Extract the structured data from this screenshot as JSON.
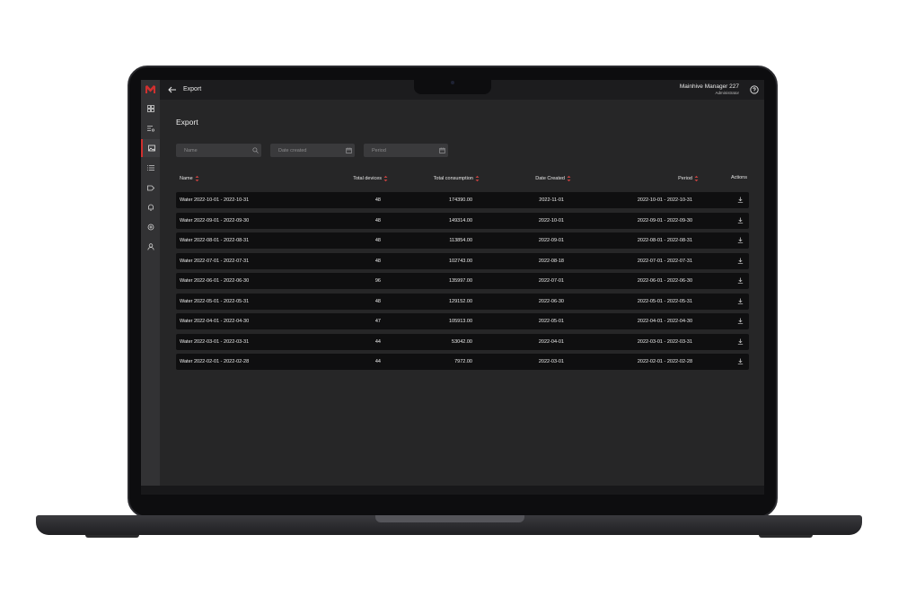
{
  "topbar": {
    "title": "Export",
    "user_name": "Mainhive Manager 227",
    "user_role": "Administrator"
  },
  "page": {
    "title": "Export"
  },
  "filters": {
    "name_placeholder": "Name",
    "date_created_placeholder": "Date created",
    "period_placeholder": "Period"
  },
  "columns": {
    "name": "Name",
    "total_devices": "Total devices",
    "total_consumption": "Total consumption",
    "date_created": "Date Created",
    "period": "Period",
    "actions": "Actions"
  },
  "rows": [
    {
      "name": "Water 2022-10-01 - 2022-10-31",
      "devices": "48",
      "consumption": "174390.00",
      "created": "2022-11-01",
      "period": "2022-10-01 - 2022-10-31"
    },
    {
      "name": "Water 2022-09-01 - 2022-09-30",
      "devices": "48",
      "consumption": "149314.00",
      "created": "2022-10-01",
      "period": "2022-09-01 - 2022-09-30"
    },
    {
      "name": "Water 2022-08-01 - 2022-08-31",
      "devices": "48",
      "consumption": "113854.00",
      "created": "2022-09-01",
      "period": "2022-08-01 - 2022-08-31"
    },
    {
      "name": "Water 2022-07-01 - 2022-07-31",
      "devices": "48",
      "consumption": "102743.00",
      "created": "2022-08-18",
      "period": "2022-07-01 - 2022-07-31"
    },
    {
      "name": "Water 2022-06-01 - 2022-06-30",
      "devices": "96",
      "consumption": "135997.00",
      "created": "2022-07-01",
      "period": "2022-06-01 - 2022-06-30"
    },
    {
      "name": "Water 2022-05-01 - 2022-05-31",
      "devices": "48",
      "consumption": "129152.00",
      "created": "2022-06-30",
      "period": "2022-05-01 - 2022-05-31"
    },
    {
      "name": "Water 2022-04-01 - 2022-04-30",
      "devices": "47",
      "consumption": "105913.00",
      "created": "2022-05-01",
      "period": "2022-04-01 - 2022-04-30"
    },
    {
      "name": "Water 2022-03-01 - 2022-03-31",
      "devices": "44",
      "consumption": "53042.00",
      "created": "2022-04-01",
      "period": "2022-03-01 - 2022-03-31"
    },
    {
      "name": "Water 2022-02-01 - 2022-02-28",
      "devices": "44",
      "consumption": "7972.00",
      "created": "2022-03-01",
      "period": "2022-02-01 - 2022-02-28"
    }
  ],
  "icons": {
    "logo": "brand-logo-icon",
    "back": "arrow-left-icon",
    "help": "help-icon",
    "search": "search-icon",
    "calendar": "calendar-icon",
    "sort": "sort-icon",
    "download": "download-icon"
  },
  "colors": {
    "accent": "#d0302f",
    "background": "#262627",
    "row_background": "#0f0f10"
  }
}
